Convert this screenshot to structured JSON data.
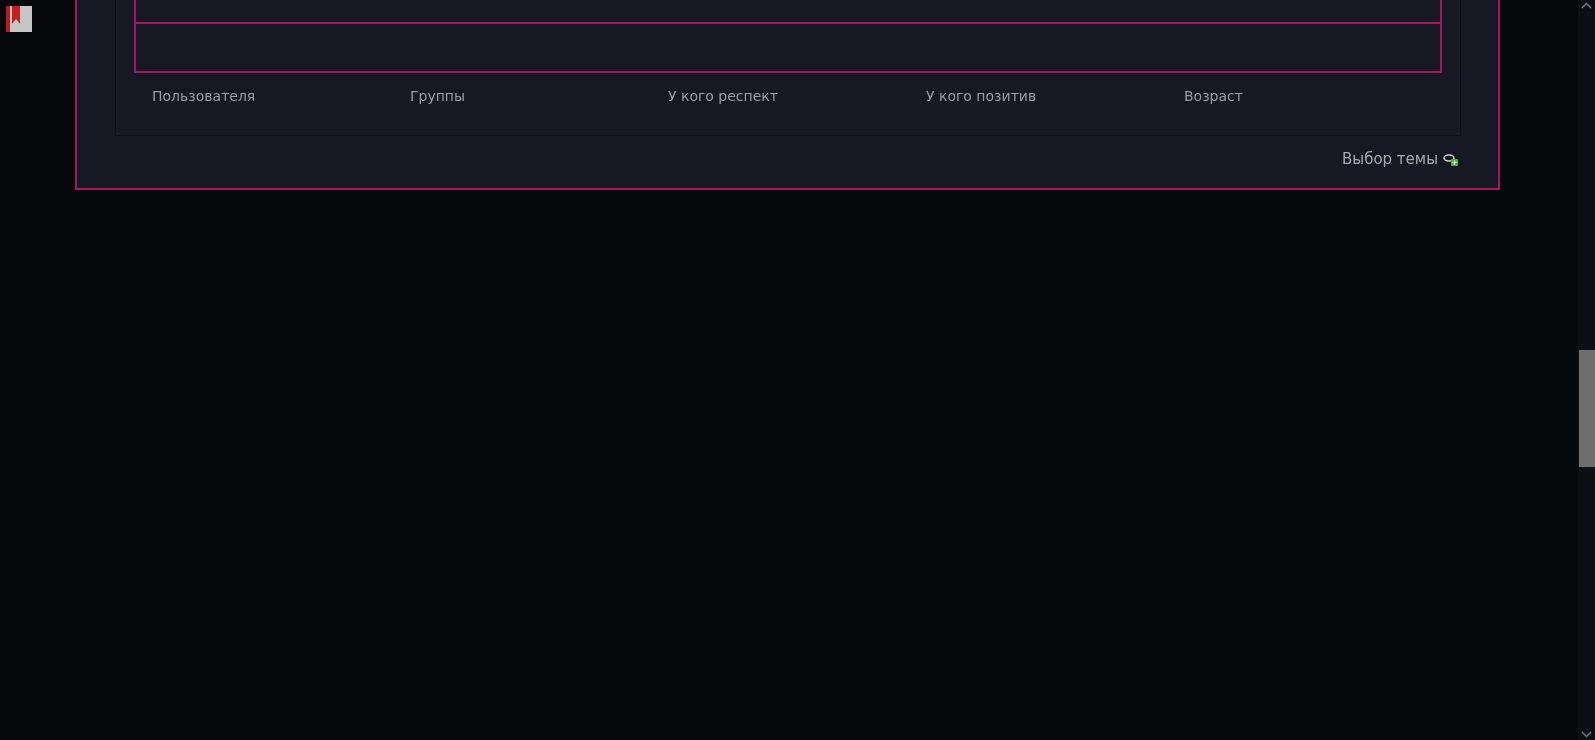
{
  "stats_columns": [
    "Пользователя",
    "Группы",
    "У кого респект",
    "У кого позитив",
    "Возраст"
  ],
  "theme_link": "Выбор темы"
}
